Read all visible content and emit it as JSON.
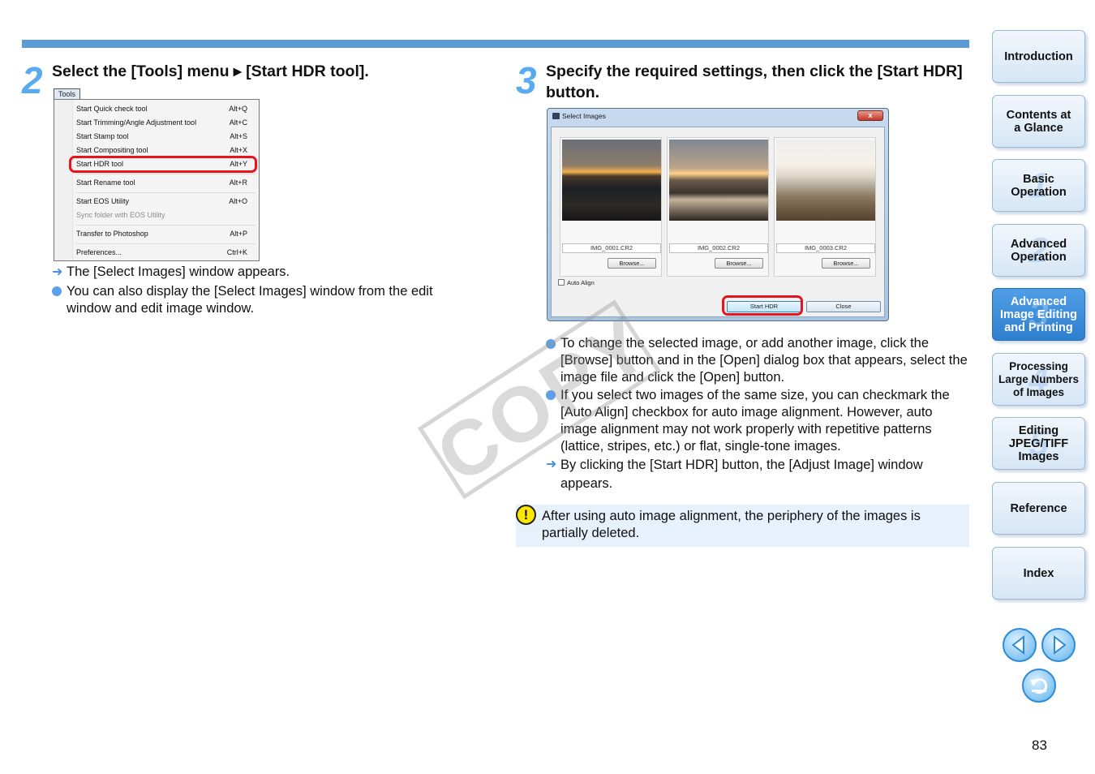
{
  "step2": {
    "number": "2",
    "title": "Select the [Tools] menu ▸ [Start HDR tool].",
    "menu_tab": "Tools",
    "menu_items": [
      {
        "label": "Start Quick check tool",
        "shortcut": "Alt+Q"
      },
      {
        "label": "Start Trimming/Angle Adjustment tool",
        "shortcut": "Alt+C"
      },
      {
        "label": "Start Stamp tool",
        "shortcut": "Alt+S"
      },
      {
        "label": "Start Compositing tool",
        "shortcut": "Alt+X"
      },
      {
        "label": "Start HDR tool",
        "shortcut": "Alt+Y"
      },
      {
        "label": "Start Rename tool",
        "shortcut": "Alt+R"
      },
      {
        "label": "Start EOS Utility",
        "shortcut": "Alt+O"
      },
      {
        "label": "Sync folder with EOS Utility",
        "shortcut": ""
      },
      {
        "label": "Transfer to Photoshop",
        "shortcut": "Alt+P"
      },
      {
        "label": "Preferences...",
        "shortcut": "Ctrl+K"
      }
    ],
    "result": "The [Select Images] window appears.",
    "bullet": "You can also display the [Select Images] window from the edit window and edit image window."
  },
  "step3": {
    "number": "3",
    "title": "Specify the required settings, then click the [Start HDR] button.",
    "dialog": {
      "title": "Select Images",
      "close": "x",
      "files": [
        "IMG_0001.CR2",
        "IMG_0002.CR2",
        "IMG_0003.CR2"
      ],
      "browse_label": "Browse...",
      "auto_align_label": "Auto Align",
      "start_hdr_label": "Start HDR",
      "close_label": "Close"
    },
    "bullet1": "To change the selected image, or add another image, click the [Browse] button and in the [Open] dialog box that appears, select the image file and click the [Open] button.",
    "bullet2": "If you select two images of the same size, you can checkmark the [Auto Align] checkbox for auto image alignment. However, auto image alignment may not work properly with repetitive patterns (lattice, stripes, etc.) or flat, single-tone images.",
    "result": "By clicking the [Start HDR] button, the [Adjust Image] window appears.",
    "note": "After using auto image alignment, the periphery of the images is partially deleted."
  },
  "watermark": "COPY",
  "sidebar": {
    "introduction": "Introduction",
    "contents_1": "Contents at",
    "contents_2": "a Glance",
    "basic_1": "Basic",
    "basic_2": "Operation",
    "advanced_1": "Advanced",
    "advanced_2": "Operation",
    "adv_edit_1": "Advanced",
    "adv_edit_2": "Image Editing",
    "adv_edit_3": "and Printing",
    "processing_1": "Processing",
    "processing_2": "Large Numbers",
    "processing_3": "of Images",
    "jpeg_1": "Editing",
    "jpeg_2": "JPEG/TIFF",
    "jpeg_3": "Images",
    "reference": "Reference",
    "index": "Index",
    "chapter_numbers": [
      "1",
      "2",
      "3",
      "4",
      "5"
    ]
  },
  "page_number": "83"
}
